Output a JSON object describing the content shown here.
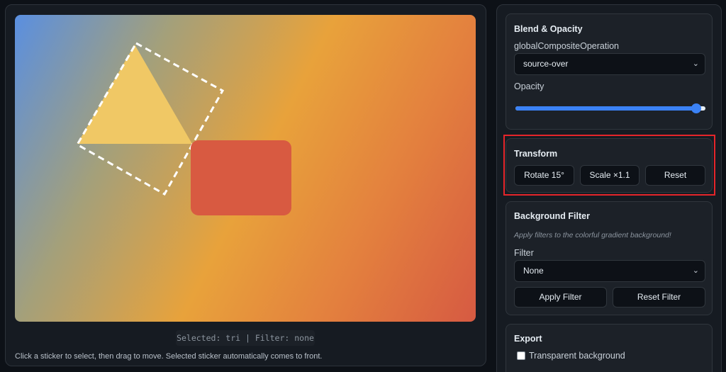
{
  "canvas": {
    "status_text": "Selected: tri | Filter: none",
    "hint_text": "Click a sticker to select, then drag to move. Selected sticker automatically comes to front.",
    "stickers": [
      {
        "id": "tri",
        "kind": "triangle",
        "color": "#f0c865",
        "selected": true
      },
      {
        "id": "rect",
        "kind": "rounded-rect",
        "color": "#d85a41",
        "selected": false
      }
    ],
    "selection_color": "#ffffff"
  },
  "blend": {
    "title": "Blend & Opacity",
    "op_label": "globalCompositeOperation",
    "op_value": "source-over",
    "opacity_label": "Opacity",
    "opacity_value": 0.95
  },
  "transform": {
    "title": "Transform",
    "rotate_label": "Rotate 15°",
    "scale_label": "Scale ×1.1",
    "reset_label": "Reset"
  },
  "bg_filter": {
    "title": "Background Filter",
    "description": "Apply filters to the colorful gradient background!",
    "filter_label": "Filter",
    "filter_value": "None",
    "apply_label": "Apply Filter",
    "reset_label": "Reset Filter"
  },
  "export": {
    "title": "Export",
    "transparent_label": "Transparent background",
    "transparent_checked": false
  },
  "colors": {
    "accent": "#3b82f6",
    "highlight": "#e5252a",
    "background": "#0d1117"
  }
}
